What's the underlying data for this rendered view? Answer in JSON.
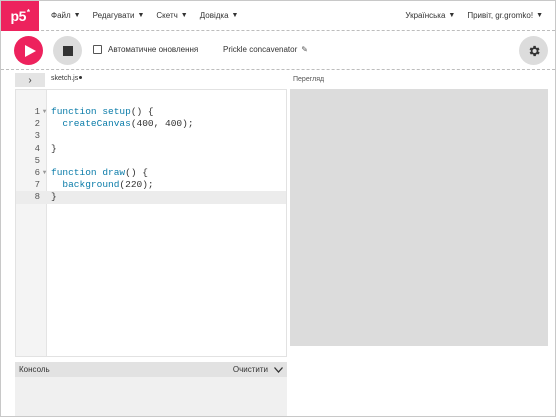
{
  "nav": {
    "logo": "p5",
    "logo_sup": "*",
    "menu": [
      {
        "label": "Файл"
      },
      {
        "label": "Редагувати"
      },
      {
        "label": "Скетч"
      },
      {
        "label": "Довідка"
      }
    ],
    "language": "Українська",
    "greeting": "Привіт, gr.gromko!",
    "caret": "▼"
  },
  "toolbar": {
    "auto_refresh_label": "Автоматичне оновлення",
    "auto_refresh_checked": false,
    "sketch_name": "Prickle concavenator",
    "pencil": "✎"
  },
  "editor": {
    "sidebar_toggle": "›",
    "file_tab": "sketch.js",
    "preview_label": "Перегляд",
    "lines": [
      {
        "n": "1",
        "fold": true,
        "text": "function setup() {"
      },
      {
        "n": "2",
        "fold": false,
        "text": "  createCanvas(400, 400);"
      },
      {
        "n": "3",
        "fold": false,
        "text": ""
      },
      {
        "n": "4",
        "fold": false,
        "text": "}"
      },
      {
        "n": "5",
        "fold": false,
        "text": ""
      },
      {
        "n": "6",
        "fold": true,
        "text": "function draw() {"
      },
      {
        "n": "7",
        "fold": false,
        "text": "  background(220);"
      },
      {
        "n": "8",
        "fold": false,
        "text": "}"
      }
    ],
    "active_line": 8
  },
  "console": {
    "title": "Консоль",
    "clear_label": "Очистити",
    "chevron": "⌄"
  },
  "colors": {
    "accent": "#ed225d",
    "preview_bg": "#dcdcdc",
    "keyword": "#0b7ca9"
  }
}
